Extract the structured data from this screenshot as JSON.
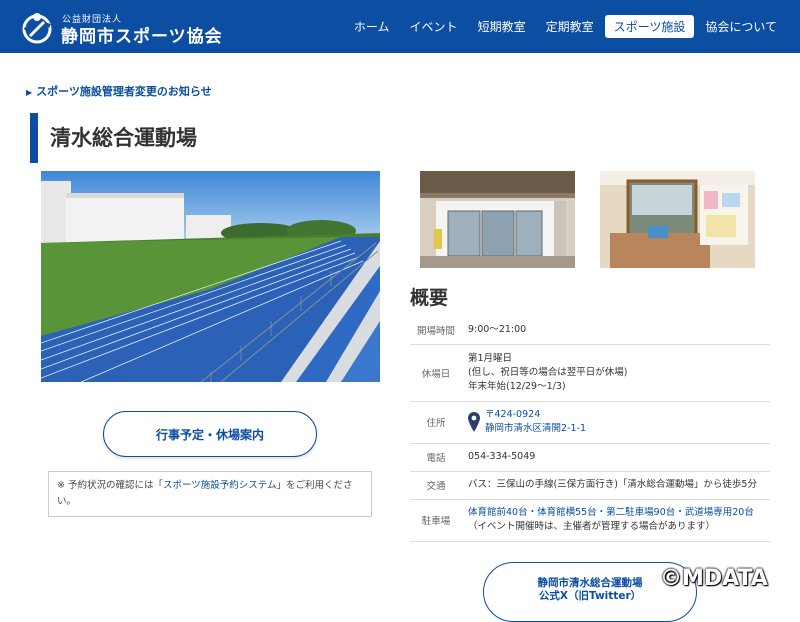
{
  "header": {
    "org_small": "公益財団法人",
    "org_name": "静岡市スポーツ協会",
    "nav": [
      {
        "label": "ホーム",
        "active": false
      },
      {
        "label": "イベント",
        "active": false
      },
      {
        "label": "短期教室",
        "active": false
      },
      {
        "label": "定期教室",
        "active": false
      },
      {
        "label": "スポーツ施設",
        "active": true
      },
      {
        "label": "協会について",
        "active": false
      }
    ]
  },
  "notice": "スポーツ施設管理者変更のお知らせ",
  "page_title": "清水総合運動場",
  "schedule_button": "行事予定・休場案内",
  "note": {
    "prefix": "※ 予約状況の確認には「",
    "link": "スポーツ施設予約システム",
    "suffix": "」をご利用ください。"
  },
  "overview": {
    "heading": "概要",
    "hours_label": "開場時間",
    "hours": "9:00〜21:00",
    "closed_label": "休場日",
    "closed_1": "第1月曜日",
    "closed_2": "(但し、祝日等の場合は翌平日が休場)",
    "closed_3": "年末年始(12/29〜1/3)",
    "address_label": "住所",
    "postal": "〒424-0924",
    "address": "静岡市清水区清開2-1-1",
    "phone_label": "電話",
    "phone": "054-334-5049",
    "transport_label": "交通",
    "transport": "バス：三保山の手線(三保方面行き)「清水総合運動場」から徒歩5分",
    "parking_label": "駐車場",
    "parking_1": "体育館前40台・体育館横55台・第二駐車場90台・武道場専用20台",
    "parking_2": "（イベント開催時は、主催者が管理する場合があります）"
  },
  "x_button": {
    "line1": "静岡市清水総合運動場",
    "line2": "公式X（旧Twitter）"
  },
  "watermark": "©MDATA",
  "colors": {
    "brand": "#0b4ea2"
  }
}
